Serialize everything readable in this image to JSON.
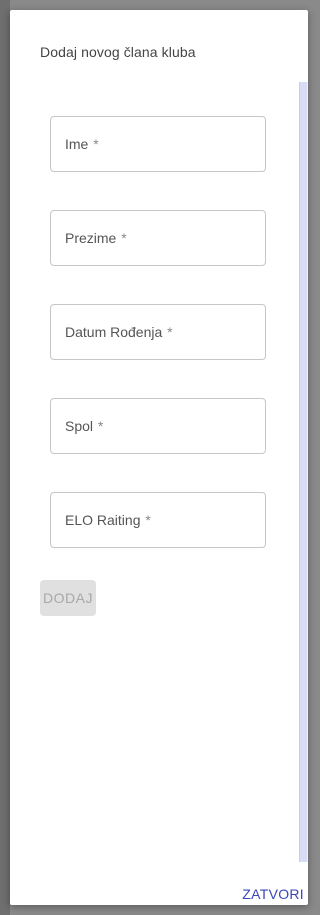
{
  "dialog": {
    "title": "Dodaj novog člana kluba",
    "fields": [
      {
        "label": "Ime",
        "required_mark": "*"
      },
      {
        "label": "Prezime",
        "required_mark": "*"
      },
      {
        "label": "Datum Rođenja",
        "required_mark": "*"
      },
      {
        "label": "Spol",
        "required_mark": "*"
      },
      {
        "label": "ELO Raiting",
        "required_mark": "*"
      }
    ],
    "add_label": "DODAJ",
    "close_label": "ZATVORI"
  },
  "colors": {
    "accent": "#3b46b8",
    "disabled_button": "#e0e0e0"
  }
}
